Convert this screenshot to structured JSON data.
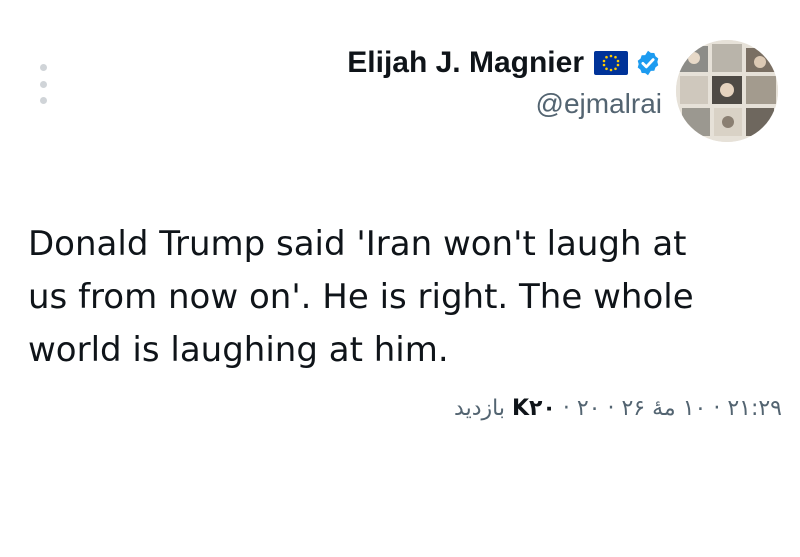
{
  "user": {
    "display_name": "Elijah J. Magnier",
    "handle": "@ejmalrai",
    "flag_icon": "eu-flag-icon",
    "verified_icon": "verified-badge-icon",
    "verified_color": "#1d9bf0"
  },
  "tweet": {
    "lines": [
      "Donald Trump said 'Iran won't laugh at",
      "us from now on'. He is right. The whole",
      "world is laughing at him."
    ]
  },
  "meta": {
    "time": "۲۱:۲۹",
    "separator": " · ",
    "date": "۱۰ مهٔ ۲۶",
    "year": "۲۰",
    "views_count": "K۲۰",
    "views_label": "بازدید"
  },
  "colors": {
    "text": "#0f1419",
    "secondary": "#536471"
  }
}
